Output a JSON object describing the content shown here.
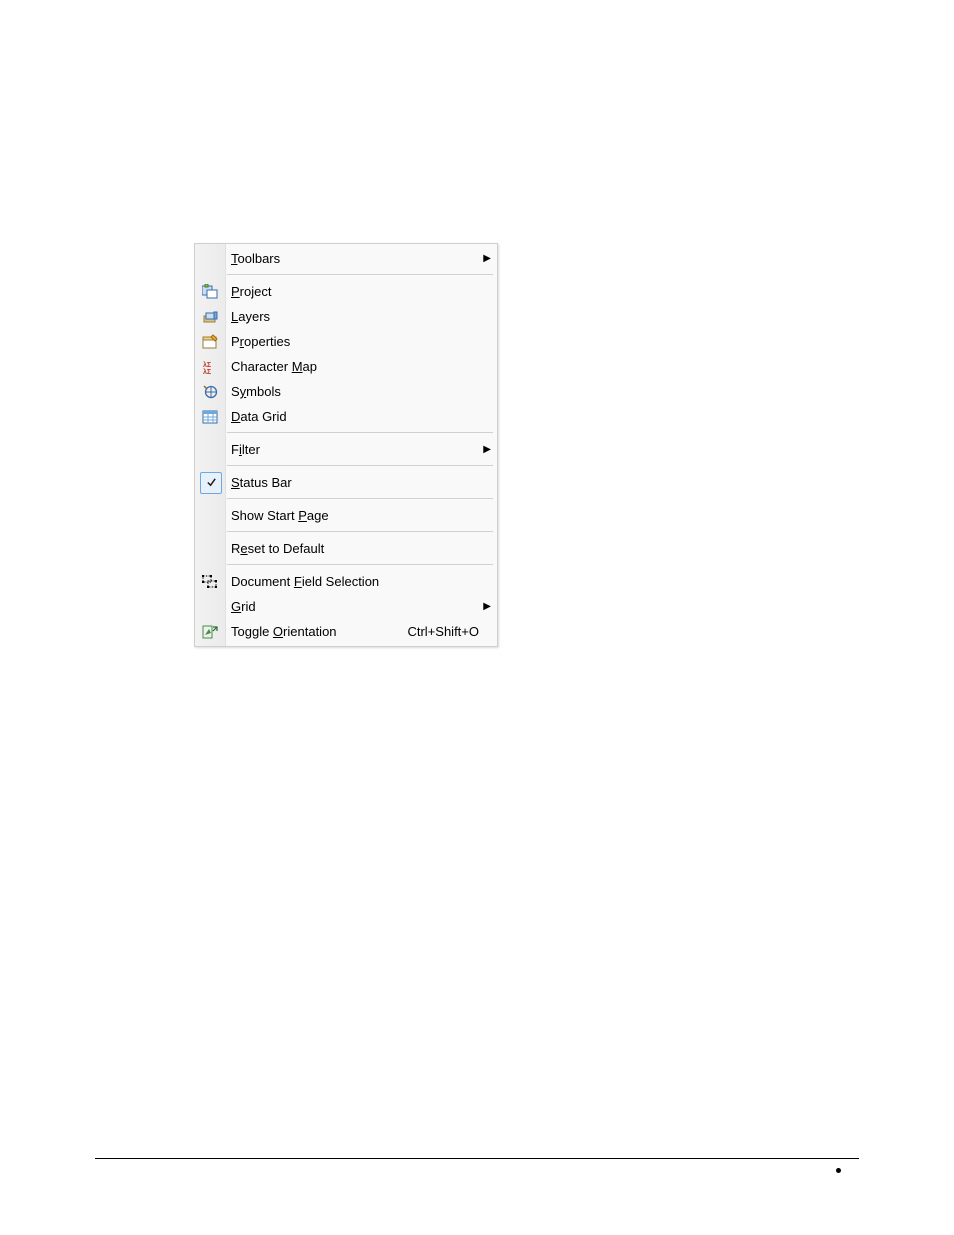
{
  "menu": {
    "items": [
      {
        "id": "toolbars",
        "label_pre": "",
        "label_u": "T",
        "label_post": "oolbars",
        "submenu": true
      },
      null,
      {
        "id": "project",
        "label_pre": "",
        "label_u": "P",
        "label_post": "roject",
        "icon": "project-icon"
      },
      {
        "id": "layers",
        "label_pre": "",
        "label_u": "L",
        "label_post": "ayers",
        "icon": "layers-icon"
      },
      {
        "id": "properties",
        "label_pre": "P",
        "label_u": "r",
        "label_post": "operties",
        "icon": "properties-icon"
      },
      {
        "id": "charmap",
        "label_pre": "Character ",
        "label_u": "M",
        "label_post": "ap",
        "icon": "character-map-icon"
      },
      {
        "id": "symbols",
        "label_pre": "S",
        "label_u": "y",
        "label_post": "mbols",
        "icon": "symbols-icon"
      },
      {
        "id": "datagrid",
        "label_pre": "",
        "label_u": "D",
        "label_post": "ata Grid",
        "icon": "data-grid-icon"
      },
      null,
      {
        "id": "filter",
        "label_pre": "F",
        "label_u": "i",
        "label_post": "lter",
        "submenu": true
      },
      null,
      {
        "id": "statusbar",
        "label_pre": "",
        "label_u": "S",
        "label_post": "tatus Bar",
        "checked": true
      },
      null,
      {
        "id": "startpage",
        "label_pre": "Show Start ",
        "label_u": "P",
        "label_post": "age"
      },
      null,
      {
        "id": "reset",
        "label_pre": "R",
        "label_u": "e",
        "label_post": "set to Default"
      },
      null,
      {
        "id": "docfield",
        "label_pre": "Document ",
        "label_u": "F",
        "label_post": "ield Selection",
        "icon": "field-selection-icon"
      },
      {
        "id": "grid",
        "label_pre": "",
        "label_u": "G",
        "label_post": "rid",
        "submenu": true
      },
      {
        "id": "toggleori",
        "label_pre": "Toggle ",
        "label_u": "O",
        "label_post": "rientation",
        "shortcut": "Ctrl+Shift+O",
        "icon": "toggle-orientation-icon"
      }
    ]
  }
}
